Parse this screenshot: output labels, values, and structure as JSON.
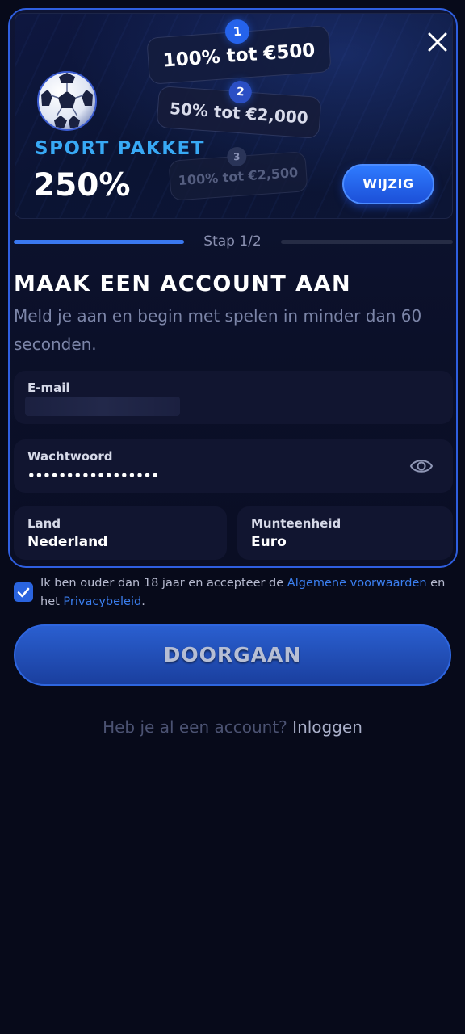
{
  "banner": {
    "tiers": [
      {
        "number": "1",
        "text": "100% tot €500"
      },
      {
        "number": "2",
        "text": "50% tot €2,000"
      },
      {
        "number": "3",
        "text": "100% tot €2,500"
      }
    ],
    "package_title": "SPORT PAKKET",
    "package_percent": "250%",
    "change_button": "WIJZIG",
    "icons": {
      "close": "close-icon",
      "ball": "soccer-ball-icon"
    }
  },
  "step": {
    "label": "Stap 1/2",
    "progress": 0.5
  },
  "form": {
    "title": "MAAK EEN ACCOUNT AAN",
    "subtitle": "Meld je aan en begin met spelen in minder dan 60 seconden.",
    "email": {
      "label": "E-mail",
      "value": ""
    },
    "password": {
      "label": "Wachtwoord",
      "value": "•••••••••••••••••"
    },
    "country": {
      "label": "Land",
      "value": "Nederland"
    },
    "currency": {
      "label": "Munteenheid",
      "value": "Euro"
    }
  },
  "terms": {
    "checked": true,
    "text_before": "Ik ben ouder dan 18 jaar en accepteer de ",
    "link_terms": "Algemene voorwaarden",
    "text_middle": " en het ",
    "link_privacy": "Privacybeleid",
    "text_after": "."
  },
  "cta_label": "DOORGAAN",
  "login": {
    "question": "Heb je al een account?",
    "link": "Inloggen"
  },
  "colors": {
    "accent": "#2563eb",
    "title_blue": "#38a9f5",
    "background": "#070a1a"
  }
}
